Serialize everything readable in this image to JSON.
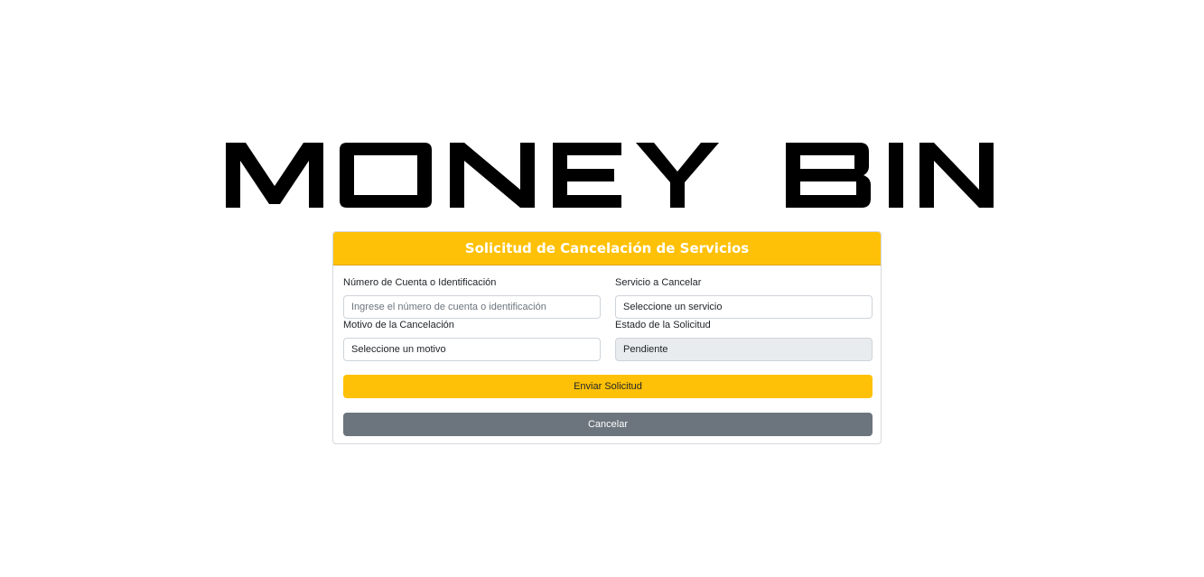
{
  "brand": {
    "logo_text": "MONEY BIN"
  },
  "form": {
    "title": "Solicitud de Cancelación de Servicios",
    "account_label": "Número de Cuenta o Identificación",
    "account_placeholder": "Ingrese el número de cuenta o identificación",
    "service_label": "Servicio a Cancelar",
    "service_value": "Seleccione un servicio",
    "reason_label": "Motivo de la Cancelación",
    "reason_value": "Seleccione un motivo",
    "status_label": "Estado de la Solicitud",
    "status_value": "Pendiente",
    "submit_label": "Enviar Solicitud",
    "cancel_label": "Cancelar"
  },
  "colors": {
    "accent": "#ffc107",
    "secondary": "#6c757d",
    "readonly_bg": "#e9ecef"
  }
}
